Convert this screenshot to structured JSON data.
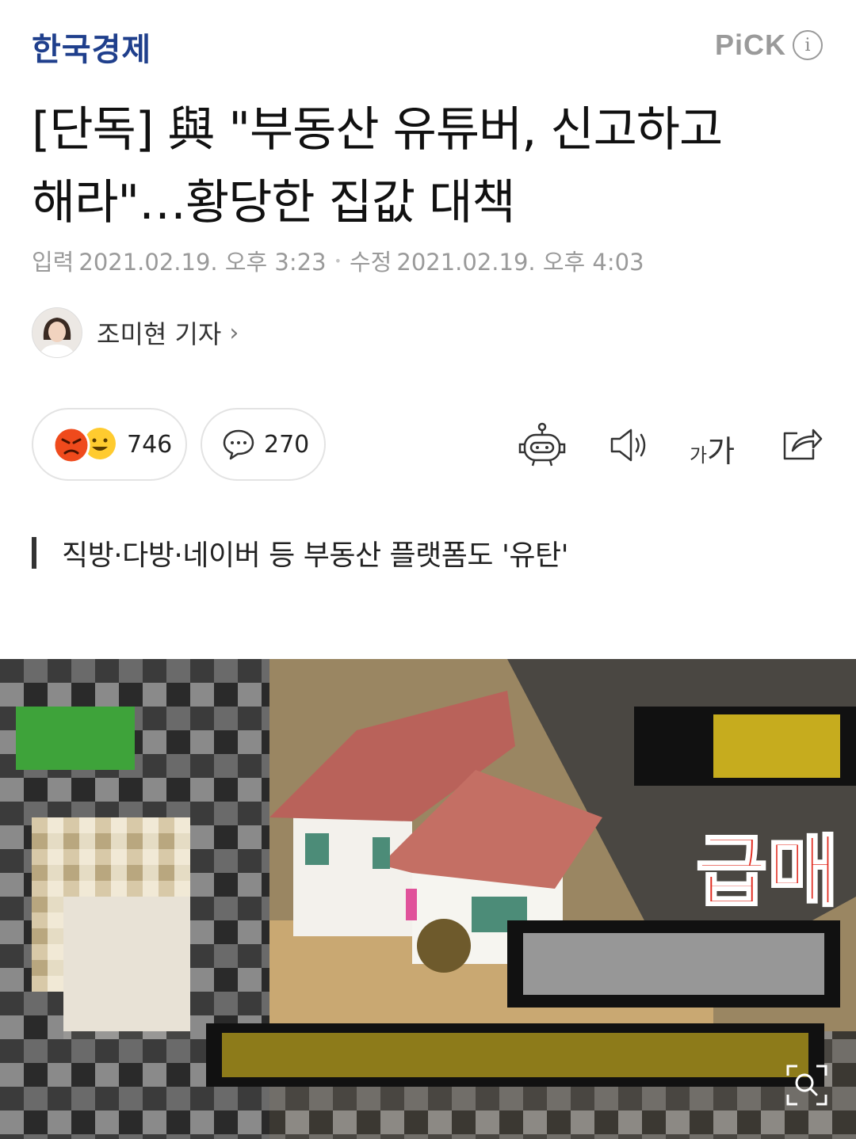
{
  "header": {
    "press_name": "한국경제",
    "pick_label": "PiCK",
    "info_glyph": "i"
  },
  "article": {
    "title_line1": "[단독] 與 \"부동산 유튜버, 신고하고",
    "title_line2": "해라\"…황당한 집값 대책",
    "input_label": "입력",
    "input_date": "2021.02.19. 오후 3:23",
    "modified_label": "수정",
    "modified_date": "2021.02.19. 오후 4:03",
    "reporter": "조미현 기자",
    "subhead": "직방·다방·네이버 등 부동산 플랫폼도 '유탄'"
  },
  "actions": {
    "reaction_count": "746",
    "comment_count": "270",
    "font_size_label_small": "가",
    "font_size_label_large": "가"
  },
  "photo": {
    "overlay_text_sale": "급매"
  },
  "icons": [
    "info-icon",
    "angry-emoji-icon",
    "smile-emoji-icon",
    "comment-bubble-icon",
    "robot-summary-icon",
    "speaker-icon",
    "share-icon",
    "zoom-icon"
  ],
  "colors": {
    "press_blue": "#1f3f8c",
    "muted_gray": "#9a9a9a",
    "sale_red": "#e0261a"
  }
}
